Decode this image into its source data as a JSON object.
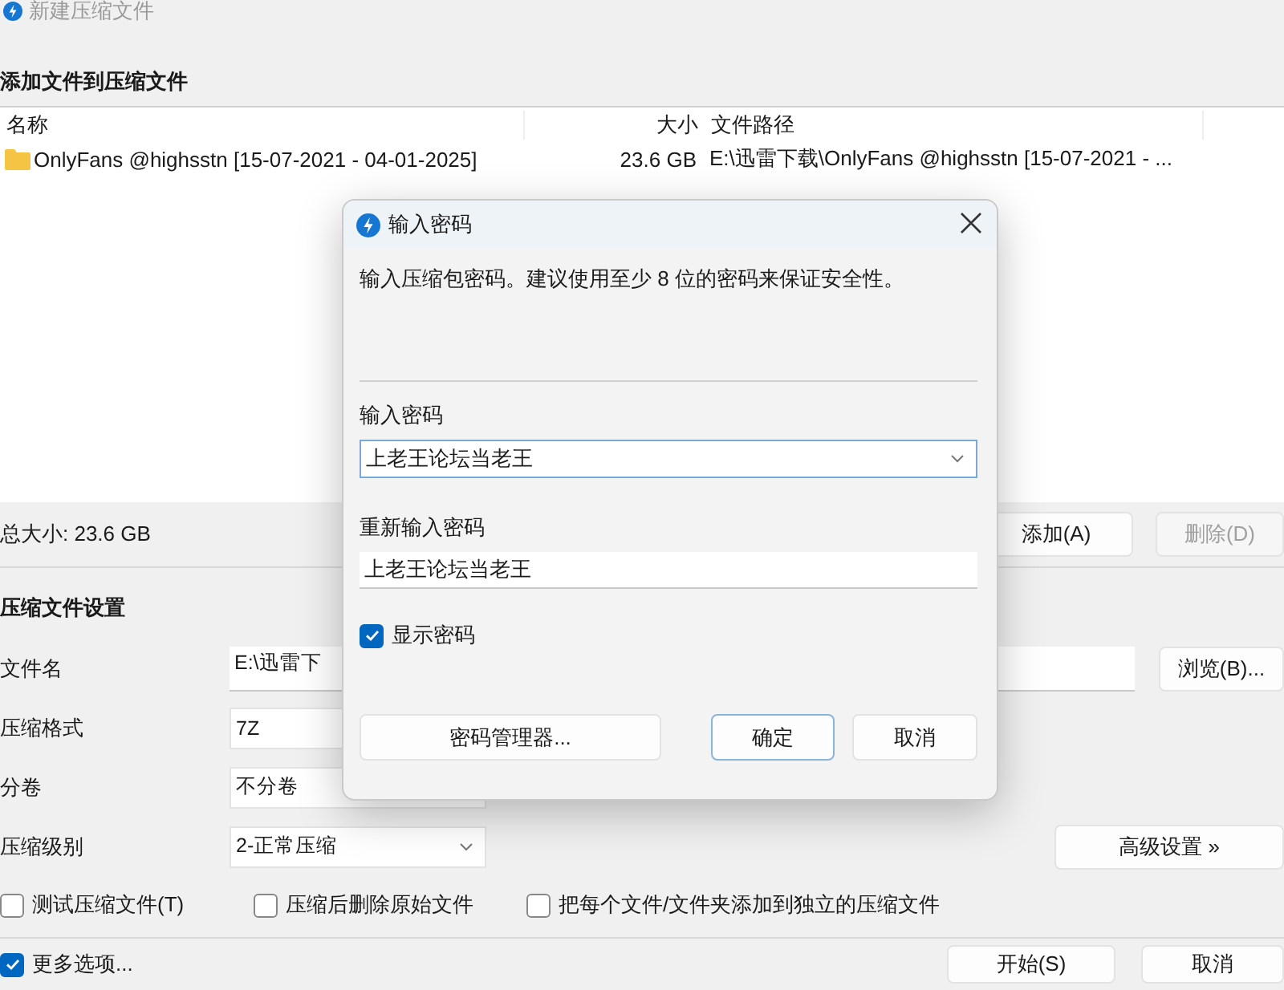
{
  "window": {
    "title": "新建压缩文件"
  },
  "files": {
    "heading": "添加文件到压缩文件",
    "columns": [
      "名称",
      "大小",
      "文件路径"
    ],
    "rows": [
      {
        "name": "OnlyFans @highsstn [15-07-2021 - 04-01-2025]",
        "size": "23.6 GB",
        "path": "E:\\迅雷下载\\OnlyFans @highsstn [15-07-2021 - ..."
      }
    ],
    "total": "总大小: 23.6 GB",
    "buttons": [
      {
        "label": "添加(A)",
        "disabled": false
      },
      {
        "label": "删除(D)",
        "disabled": true
      }
    ]
  },
  "settings": {
    "heading": "压缩文件设置",
    "fields": [
      {
        "label": "文件名",
        "value": "E:\\迅雷下",
        "kind": "text",
        "button": "浏览(B)..."
      },
      {
        "label": "压缩格式",
        "value": "7Z",
        "kind": "choice"
      },
      {
        "label": "分卷",
        "value": "不分卷",
        "kind": "choice"
      },
      {
        "label": "压缩级别",
        "value": "2-正常压缩",
        "kind": "dropdown",
        "button": "高级设置 »"
      }
    ],
    "options": [
      {
        "label": "测试压缩文件(T)",
        "checked": false
      },
      {
        "label": "压缩后删除原始文件",
        "checked": false
      },
      {
        "label": "把每个文件/文件夹添加到独立的压缩文件",
        "checked": false
      }
    ]
  },
  "footer": {
    "more_options": {
      "label": "更多选项...",
      "checked": true
    },
    "buttons": [
      "开始(S)",
      "取消"
    ]
  },
  "dialog": {
    "title": "输入密码",
    "description": "输入压缩包密码。建议使用至少 8 位的密码来保证安全性。",
    "password_label": "输入密码",
    "password": "上老王论坛当老王",
    "confirm_label": "重新输入密码",
    "confirm": "上老王论坛当老王",
    "show_password": {
      "label": "显示密码",
      "checked": true
    },
    "buttons": [
      {
        "label": "密码管理器...",
        "default": false
      },
      {
        "label": "确定",
        "default": true
      },
      {
        "label": "取消",
        "default": false
      }
    ]
  }
}
